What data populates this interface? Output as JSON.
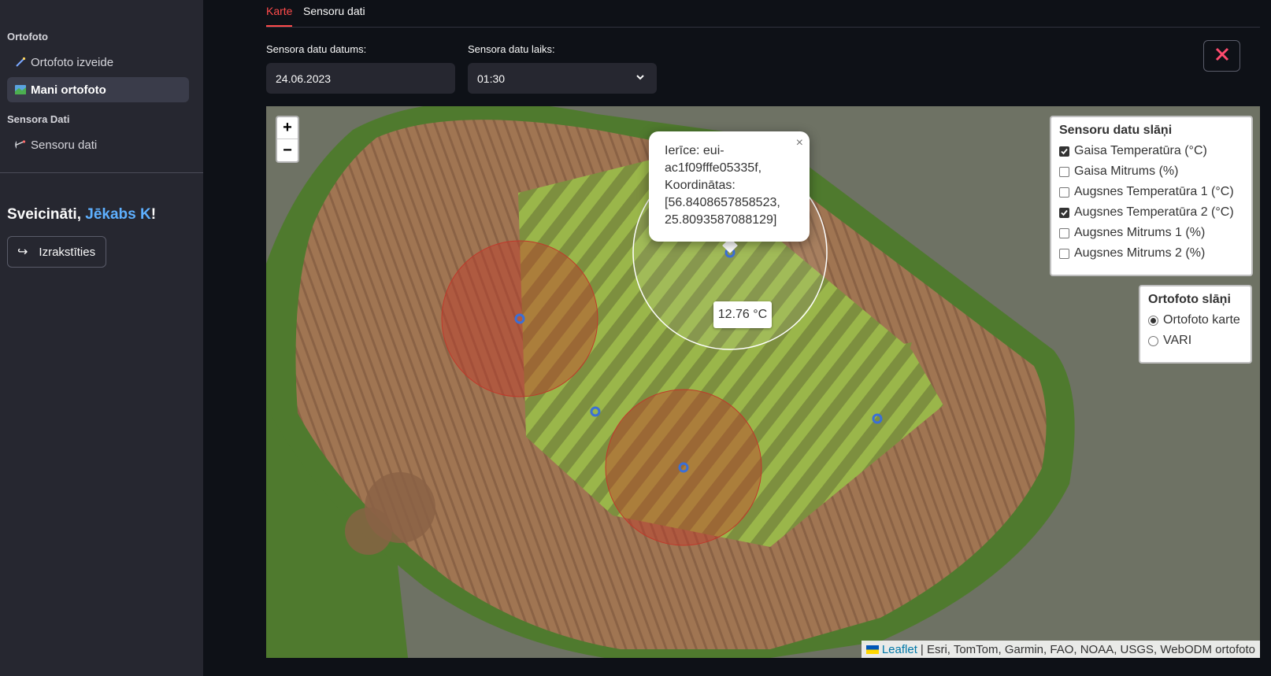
{
  "sidebar": {
    "section_ortofoto": "Ortofoto",
    "item_izveide": "Ortofoto izveide",
    "item_mani": "Mani ortofoto",
    "section_sensora": "Sensora Dati",
    "item_sensoru": "Sensoru dati",
    "greeting_prefix": "Sveicināti, ",
    "greeting_user": "Jēkabs K",
    "greeting_suffix": "!",
    "logout_label": "Izrakstīties"
  },
  "tabs": [
    "Karte",
    "Sensoru dati"
  ],
  "form": {
    "date_label": "Sensora datu datums:",
    "date_value": "24.06.2023",
    "time_label": "Sensora datu laiks:",
    "time_value": "01:30"
  },
  "map": {
    "zoom_in": "+",
    "zoom_out": "−",
    "popup": {
      "line1": "Ierīce: eui-",
      "line2": "ac1f09fffe05335f,",
      "line3": "Koordinātas:",
      "line4": "[56.8408657858523,",
      "line5": "25.8093587088129]",
      "close": "×"
    },
    "tooltip": "12.76 °C",
    "sensor_layers": {
      "title": "Sensoru datu slāņi",
      "items": [
        {
          "label": "Gaisa Temperatūra (°C)",
          "checked": true
        },
        {
          "label": "Gaisa Mitrums (%)",
          "checked": false
        },
        {
          "label": "Augsnes Temperatūra 1 (°C)",
          "checked": false
        },
        {
          "label": "Augsnes Temperatūra 2 (°C)",
          "checked": true
        },
        {
          "label": "Augsnes Mitrums 1 (%)",
          "checked": false
        },
        {
          "label": "Augsnes Mitrums 2 (%)",
          "checked": false
        }
      ]
    },
    "ortho_layers": {
      "title": "Ortofoto slāņi",
      "items": [
        {
          "label": "Ortofoto karte",
          "checked": true
        },
        {
          "label": "VARI",
          "checked": false
        }
      ]
    },
    "attribution_leaflet": "Leaflet",
    "attribution_rest": "| Esri, TomTom, Garmin, FAO, NOAA, USGS, WebODM ortofoto"
  },
  "colors": {
    "accent": "#ff4b4b",
    "user_link": "#5eb0ff",
    "sensor_marker": "#3b6fd6",
    "heat_circle": "#c0392b"
  }
}
